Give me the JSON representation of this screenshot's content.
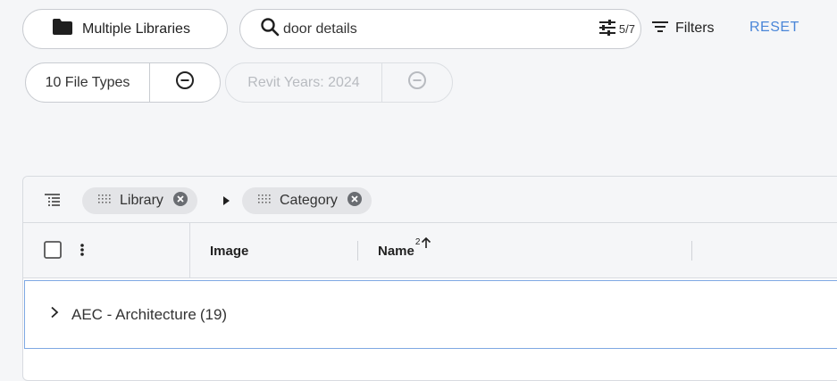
{
  "toolbar": {
    "library_label": "Multiple Libraries",
    "search_value": "door details",
    "search_count": "5/7",
    "filters_label": "Filters",
    "reset_label": "RESET"
  },
  "chips": {
    "file_types": "10 File Types",
    "revit_years": "Revit Years: 2024"
  },
  "grouping": {
    "items": [
      {
        "label": "Library"
      },
      {
        "label": "Category"
      }
    ]
  },
  "columns": {
    "image": "Image",
    "name": "Name",
    "name_sort_index": "2"
  },
  "rows": [
    {
      "label": "AEC - Architecture",
      "count": "(19)"
    }
  ],
  "colors": {
    "accent": "#4a86d8",
    "row_border": "#7ea8e3"
  }
}
